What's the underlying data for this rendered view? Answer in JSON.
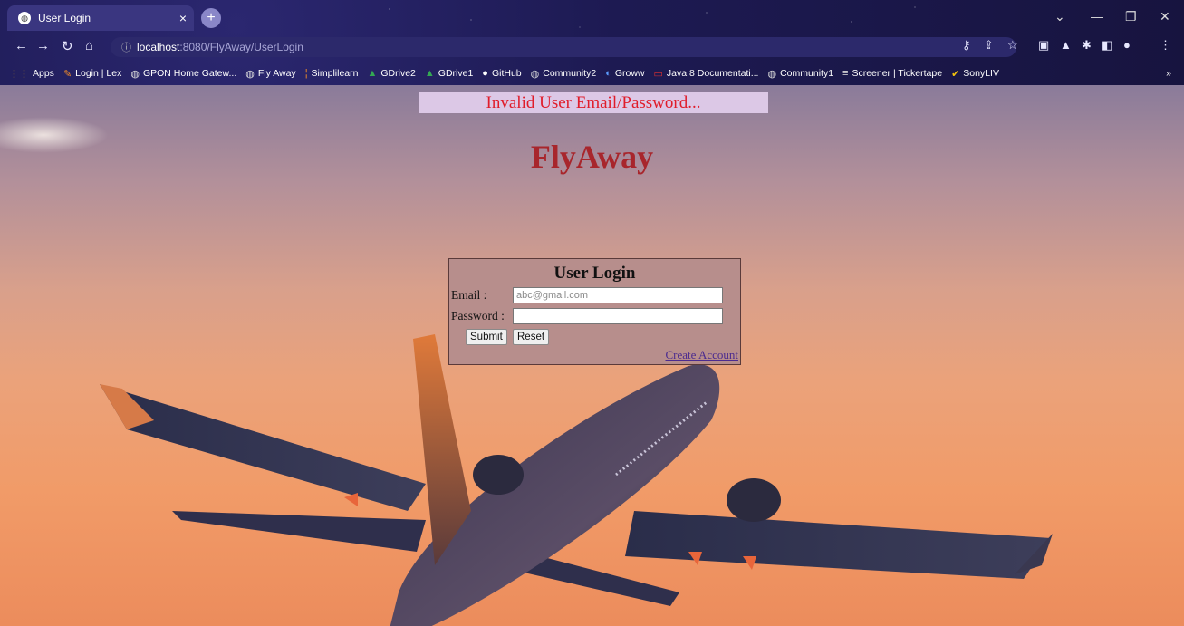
{
  "browser": {
    "tab_title": "User Login",
    "tab_close": "×",
    "new_tab": "+",
    "url_host": "localhost",
    "url_path": ":8080/FlyAway/UserLogin",
    "bookmarks": [
      {
        "label": "Apps",
        "icon": "apps-grid-icon"
      },
      {
        "label": "Login | Lex",
        "icon": "lex-icon"
      },
      {
        "label": "GPON Home Gatew...",
        "icon": "globe-icon"
      },
      {
        "label": "Fly Away",
        "icon": "globe-icon"
      },
      {
        "label": "Simplilearn",
        "icon": "simplilearn-icon"
      },
      {
        "label": "GDrive2",
        "icon": "gdrive-icon"
      },
      {
        "label": "GDrive1",
        "icon": "gdrive-icon"
      },
      {
        "label": "GitHub",
        "icon": "github-icon"
      },
      {
        "label": "Community2",
        "icon": "globe-icon"
      },
      {
        "label": "Groww",
        "icon": "groww-icon"
      },
      {
        "label": "Java 8 Documentati...",
        "icon": "oracle-icon"
      },
      {
        "label": "Community1",
        "icon": "globe-icon"
      },
      {
        "label": "Screener | Tickertape",
        "icon": "tickertape-icon"
      },
      {
        "label": "SonyLIV",
        "icon": "sonyliv-icon"
      }
    ],
    "overflow": "»"
  },
  "page": {
    "error_message": "Invalid User Email/Password...",
    "brand": "FlyAway",
    "login": {
      "title": "User Login",
      "email_label": "Email :",
      "email_placeholder": "abc@gmail.com",
      "password_label": "Password :",
      "submit_label": "Submit",
      "reset_label": "Reset",
      "create_account": "Create Account"
    }
  }
}
